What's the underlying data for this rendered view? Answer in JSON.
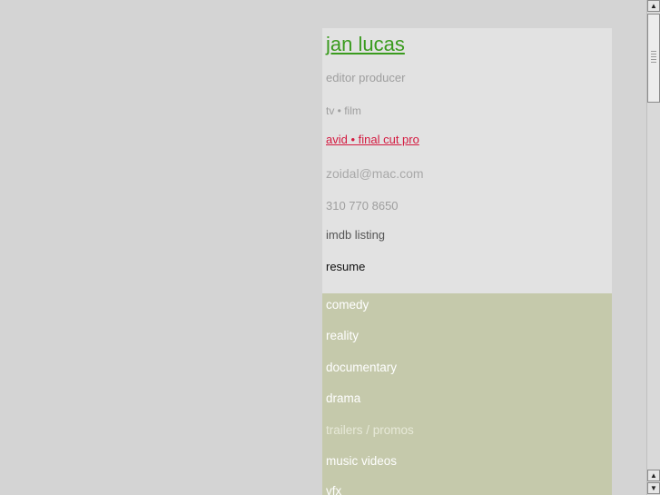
{
  "profile": {
    "name": "jan lucas",
    "roles": "editor  producer",
    "media": "tv • film",
    "software": "avid • final cut pro",
    "email": "zoidal@mac.com",
    "phone": "310 770 8650",
    "imdb_label": "imdb listing",
    "resume_label": "resume"
  },
  "menu": {
    "items": [
      {
        "label": "comedy"
      },
      {
        "label": "reality"
      },
      {
        "label": "documentary"
      },
      {
        "label": "drama"
      },
      {
        "label": "trailers / promos"
      },
      {
        "label": "music videos"
      },
      {
        "label": "vfx"
      }
    ]
  },
  "scrollbar": {
    "up_icon": "arrow-up-icon",
    "down_icon": "arrow-down-icon"
  },
  "colors": {
    "page_background": "#d4d4d4",
    "info_panel": "#e2e2e2",
    "menu_panel": "#c5c9ab",
    "name_link": "#3a9b1e",
    "software_link": "#d41a40"
  }
}
